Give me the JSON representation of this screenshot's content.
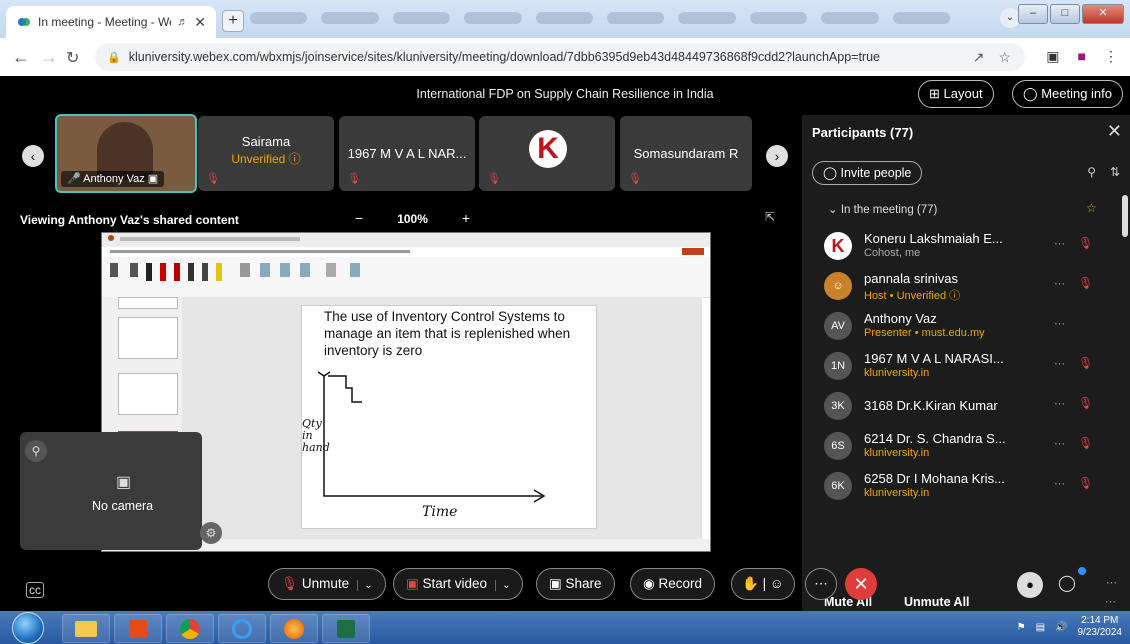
{
  "browser": {
    "tab_title": "In meeting - Meeting - Webe",
    "url": "kluniversity.webex.com/wbxmjs/joinservice/sites/kluniversity/meeting/download/7dbb6395d9eb43d48449736868f9cdd2?launchApp=true"
  },
  "meeting": {
    "title": "International FDP on Supply Chain Resilience in India",
    "layout_label": "Layout",
    "info_label": "Meeting info",
    "tiles": [
      {
        "name": "Anthony Vaz"
      },
      {
        "name": "Sairama",
        "status": "Unverified"
      },
      {
        "name": "1967 M V A L NAR..."
      },
      {
        "name": ""
      },
      {
        "name": "Somasundaram R"
      }
    ],
    "viewing_label": "Viewing Anthony Vaz's shared content",
    "zoom_minus": "−",
    "zoom_value": "100%",
    "zoom_plus": "+",
    "no_camera": "No camera"
  },
  "shared": {
    "slide_text": "The use of Inventory Control Systems to manage an item that is replenished when inventory is zero",
    "hand_qty": "Qty in hand",
    "hand_time": "Time"
  },
  "participants": {
    "title": "Participants (77)",
    "invite": "Invite people",
    "in_meeting": "In the meeting (77)",
    "rows": [
      {
        "initials": "K",
        "name": "Koneru Lakshmaiah E...",
        "sub": "Cohost, me",
        "sub_color": "#aaaaaa",
        "mic": true,
        "avatar_color": "#ffffff"
      },
      {
        "initials": "☺",
        "name": "pannala srinivas",
        "sub": "Host • Unverified ⓘ",
        "sub_color": "#f0a500",
        "mic": true,
        "avatar_color": "#c8832a"
      },
      {
        "initials": "AV",
        "name": "Anthony Vaz",
        "sub": "Presenter • must.edu.my",
        "sub_color": "#f0a500",
        "mic": false,
        "avatar_color": "#555555"
      },
      {
        "initials": "1N",
        "name": "1967 M V A L NARASI...",
        "sub": "kluniversity.in",
        "sub_color": "#f0a500",
        "mic": true,
        "avatar_color": "#555555"
      },
      {
        "initials": "3K",
        "name": "3168 Dr.K.Kiran Kumar",
        "sub": "",
        "sub_color": "#aaaaaa",
        "mic": true,
        "avatar_color": "#555555"
      },
      {
        "initials": "6S",
        "name": "6214 Dr. S. Chandra S...",
        "sub": "kluniversity.in",
        "sub_color": "#f0a500",
        "mic": true,
        "avatar_color": "#555555"
      },
      {
        "initials": "6K",
        "name": "6258 Dr I Mohana Kris...",
        "sub": "kluniversity.in",
        "sub_color": "#f0a500",
        "mic": true,
        "avatar_color": "#555555"
      }
    ],
    "mute_all": "Mute All",
    "unmute_all": "Unmute All"
  },
  "controls": {
    "unmute": "Unmute",
    "start_video": "Start video",
    "share": "Share",
    "record": "Record"
  },
  "taskbar": {
    "time": "2:14 PM",
    "date": "9/23/2024"
  },
  "colors": {
    "accent_red": "#e0474b",
    "warning": "#f0a500",
    "end_button": "#e03c3c"
  }
}
